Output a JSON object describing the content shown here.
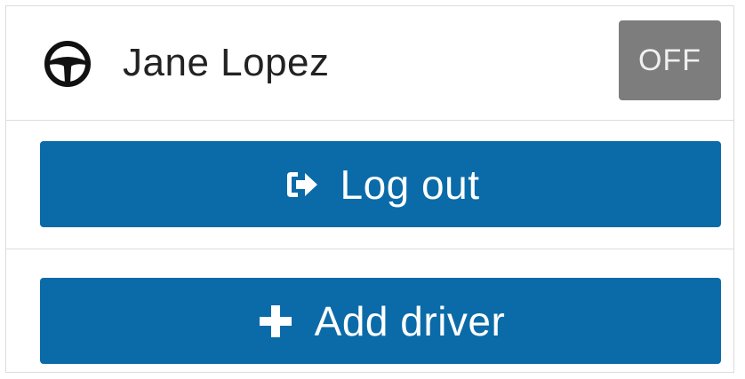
{
  "driver": {
    "name": "Jane Lopez",
    "status": "OFF",
    "icon": "steering-wheel-icon"
  },
  "actions": {
    "logout_label": "Log out",
    "logout_icon": "sign-out-icon",
    "add_driver_label": "Add driver",
    "add_driver_icon": "plus-icon"
  },
  "colors": {
    "primary_button": "#0b6ba8",
    "status_off_badge": "#7d7d7d"
  }
}
